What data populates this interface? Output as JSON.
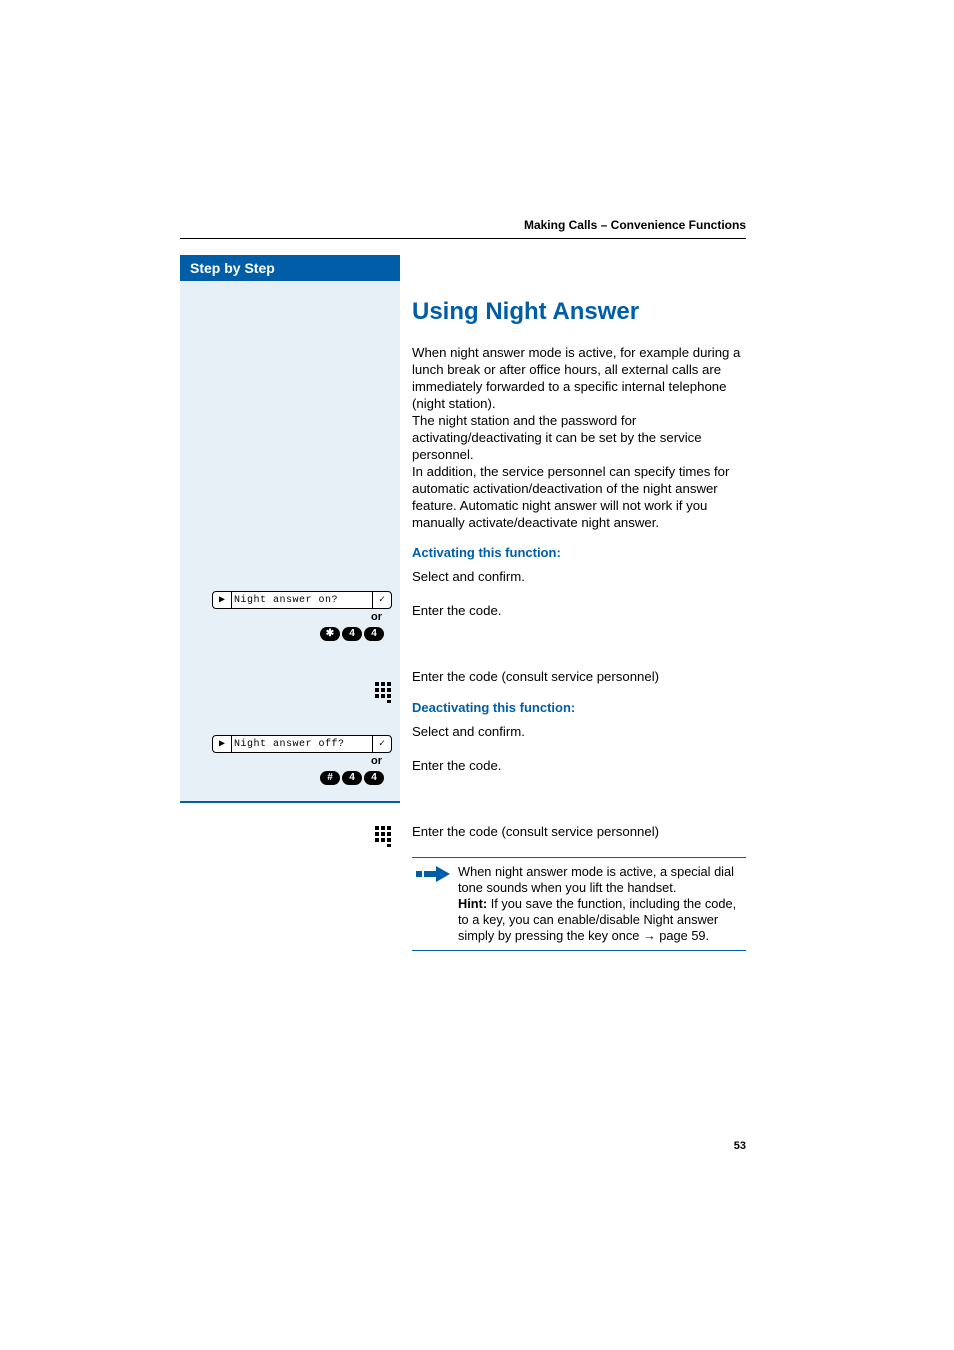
{
  "running_head": "Making Calls – Convenience Functions",
  "sidebar_title": "Step by Step",
  "section_title": "Using Night Answer",
  "intro": "When night answer mode is active, for example during a lunch break or after office hours, all external calls are immediately forwarded to a specific internal telephone (night station).\n The night station and the password for activating/deactivating it can be set by the service personnel.\nIn addition, the service personnel can specify times for automatic activation/deactivation of the night answer feature. Automatic night answer will not work if you manually activate/deactivate night answer.",
  "activate_heading": "Activating this function:",
  "deactivate_heading": "Deactivating this function:",
  "select_confirm": "Select and confirm.",
  "or": "or",
  "enter_code": "Enter the code.",
  "enter_code_consult": "Enter the code (consult service personnel)",
  "display_on": "Night answer on?",
  "display_off": "Night answer off?",
  "code_on": [
    "✱",
    "4",
    "4"
  ],
  "code_off": [
    "#",
    "4",
    "4"
  ],
  "note_line1": "When night answer mode is active, a special dial tone sounds when you lift the handset.",
  "note_hint_label": "Hint:",
  "note_hint_body": " If you save the function, including the code, to a key, you can enable/disable Night answer simply by pressing the key once ",
  "note_hint_ref": "→ page 59.",
  "page_number": "53"
}
